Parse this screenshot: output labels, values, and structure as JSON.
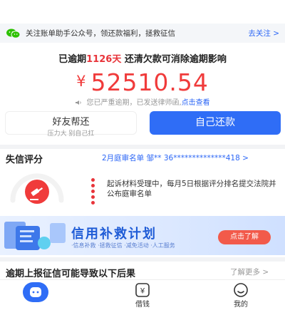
{
  "notice": {
    "text": "关注账单助手公众号，领还款福利，拯救征信",
    "follow": "去关注 >"
  },
  "summary": {
    "prefix": "已逾期",
    "days": "1126天",
    "suffix": " 还清欠款可消除逾期影响",
    "currency": "¥",
    "amount": "52510.54",
    "warning": "您已严重逾期，已发送律师函,",
    "warning_link": "点击查看"
  },
  "actions": {
    "friend_label": "好友帮还",
    "friend_sub": "压力大 别自己扛",
    "self_label": "自己还款"
  },
  "credit": {
    "title": "失信评分",
    "tag": "2月庭审名单 邹** 36**************418 >",
    "chevron": ">",
    "timeline_text": "起诉材料受理中，每月5日根据评分排名提交法院并公布庭审名单"
  },
  "banner": {
    "title": "信用补救计划",
    "subtitle": "·信息补救 ·拯救征信 ·减免活动 ·人工服务",
    "button": "点击了解"
  },
  "consequences": {
    "title": "逾期上报征信可能导致以下后果",
    "more": "了解更多 >"
  },
  "tabs": [
    {
      "label": "",
      "icon": "home-icon",
      "active": true
    },
    {
      "label": "借钱",
      "icon": "yuan-icon"
    },
    {
      "label": "我的",
      "icon": "profile-icon"
    }
  ],
  "colors": {
    "accent_blue": "#2f6df6",
    "alert_red": "#f03b3b"
  }
}
